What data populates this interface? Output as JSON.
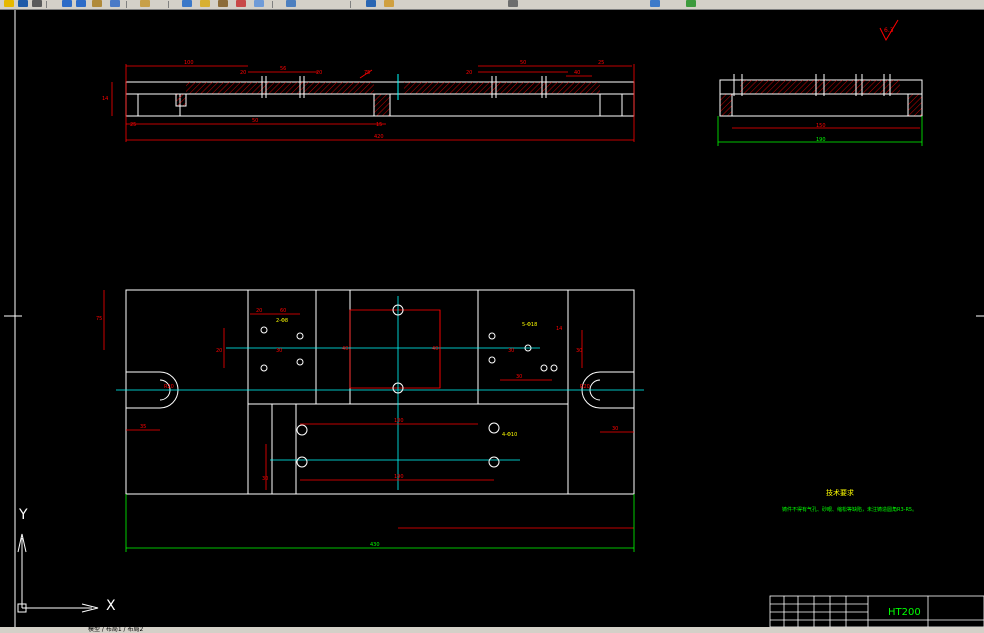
{
  "toolbar": {
    "icons": [
      "open-icon",
      "save-icon",
      "print-icon",
      "undo-icon",
      "redo-icon",
      "pan-icon",
      "zoom-icon",
      "match-properties-icon",
      "layer-icon",
      "properties-icon",
      "block-icon",
      "text-icon",
      "dimension-icon",
      "hatch-icon",
      "design-center-icon",
      "tool-palette-icon",
      "calculator-icon",
      "help-icon"
    ],
    "colors": {
      "bg": "#d4d0c8",
      "accent": "#1e5aa8"
    }
  },
  "drawing": {
    "background": "#000000",
    "ucs": {
      "x_label": "X",
      "y_label": "Y"
    },
    "roughness_symbol": "6.3",
    "technical_note_title": "技术要求",
    "technical_note_text": "铸件不得有气孔、砂眼、缩松等缺陷，未注铸造圆角R3-R5。",
    "material": "HT200",
    "colors": {
      "geometry": "#ffffff",
      "dimension": "#ff0000",
      "centerline": "#00ffff",
      "overall_dim": "#00ff00",
      "note": "#ffff00"
    },
    "top_view": {
      "dims": [
        "100",
        "56",
        "20",
        "20",
        "50",
        "25",
        "14",
        "50",
        "25",
        "15",
        "20",
        "40",
        "75",
        "420"
      ]
    },
    "side_view": {
      "dims": [
        "150",
        "190"
      ]
    },
    "plan_view": {
      "dims": [
        "75",
        "20",
        "60",
        "20",
        "35",
        "40",
        "40",
        "30",
        "30",
        "14",
        "30",
        "30",
        "100",
        "30",
        "30",
        "190",
        "430",
        "5-Φ18",
        "2-Φ8",
        "4-Φ10",
        "R20",
        "R20"
      ]
    }
  },
  "status": {
    "tabs_label": "模型 / 布局1 / 布局2"
  }
}
